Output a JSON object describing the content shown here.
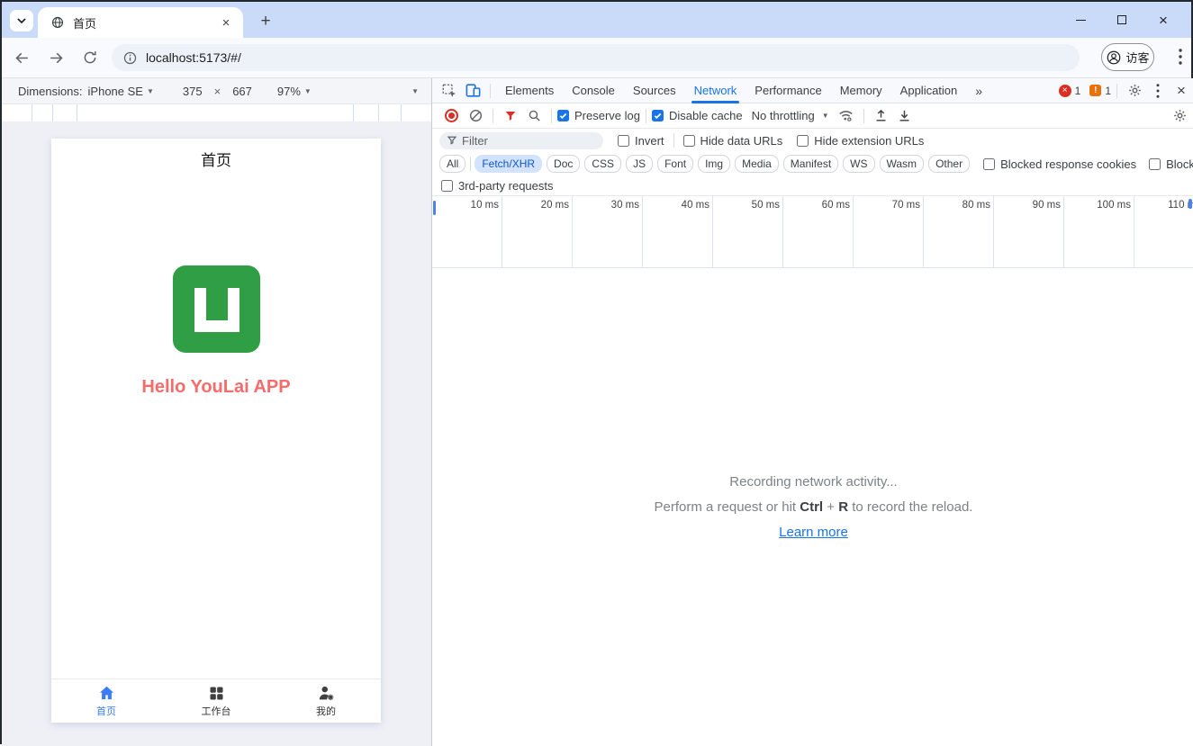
{
  "browser": {
    "tab_title": "首页",
    "new_tab_glyph": "+",
    "url": "localhost:5173/#/",
    "profile_label": "访客",
    "tab_close_glyph": "×",
    "window_close_glyph": "×"
  },
  "emulator": {
    "dimensions_label": "Dimensions:",
    "device": "iPhone SE",
    "width": "375",
    "times": "×",
    "height": "667",
    "zoom": "97%"
  },
  "app": {
    "header_title": "首页",
    "hello_text": "Hello YouLai APP",
    "tabbar": [
      {
        "label": "首页"
      },
      {
        "label": "工作台"
      },
      {
        "label": "我的"
      }
    ]
  },
  "devtools": {
    "tabs": [
      "Elements",
      "Console",
      "Sources",
      "Network",
      "Performance",
      "Memory",
      "Application"
    ],
    "overflow_tabs": "»",
    "error_count": "1",
    "warning_count": "1",
    "close_glyph": "×",
    "toolbar": {
      "preserve_log": "Preserve log",
      "disable_cache": "Disable cache",
      "throttling": "No throttling"
    },
    "filters": {
      "placeholder": "Filter",
      "invert": "Invert",
      "hide_data_urls": "Hide data URLs",
      "hide_extension_urls": "Hide extension URLs",
      "chips": [
        "All",
        "Fetch/XHR",
        "Doc",
        "CSS",
        "JS",
        "Font",
        "Img",
        "Media",
        "Manifest",
        "WS",
        "Wasm",
        "Other"
      ],
      "blocked_response_cookies": "Blocked response cookies",
      "blocked_requests": "Blocked requests",
      "third_party_requests": "3rd-party requests"
    },
    "timeline_ticks": [
      "10 ms",
      "20 ms",
      "30 ms",
      "40 ms",
      "50 ms",
      "60 ms",
      "70 ms",
      "80 ms",
      "90 ms",
      "100 ms",
      "110 ms"
    ],
    "empty_state": {
      "title": "Recording network activity...",
      "hint_prefix": "Perform a request or hit ",
      "key1": "Ctrl",
      "key_join": " + ",
      "key2": "R",
      "hint_suffix": " to record the reload.",
      "learn_more": "Learn more"
    }
  },
  "colors": {
    "accent_blue": "#1a73e8",
    "error_red": "#d93025",
    "warning_orange": "#e8710a",
    "logo_green": "#2f9e44",
    "hello_red": "#f56c6c",
    "tab_strip_blue": "#c9dbf8"
  }
}
